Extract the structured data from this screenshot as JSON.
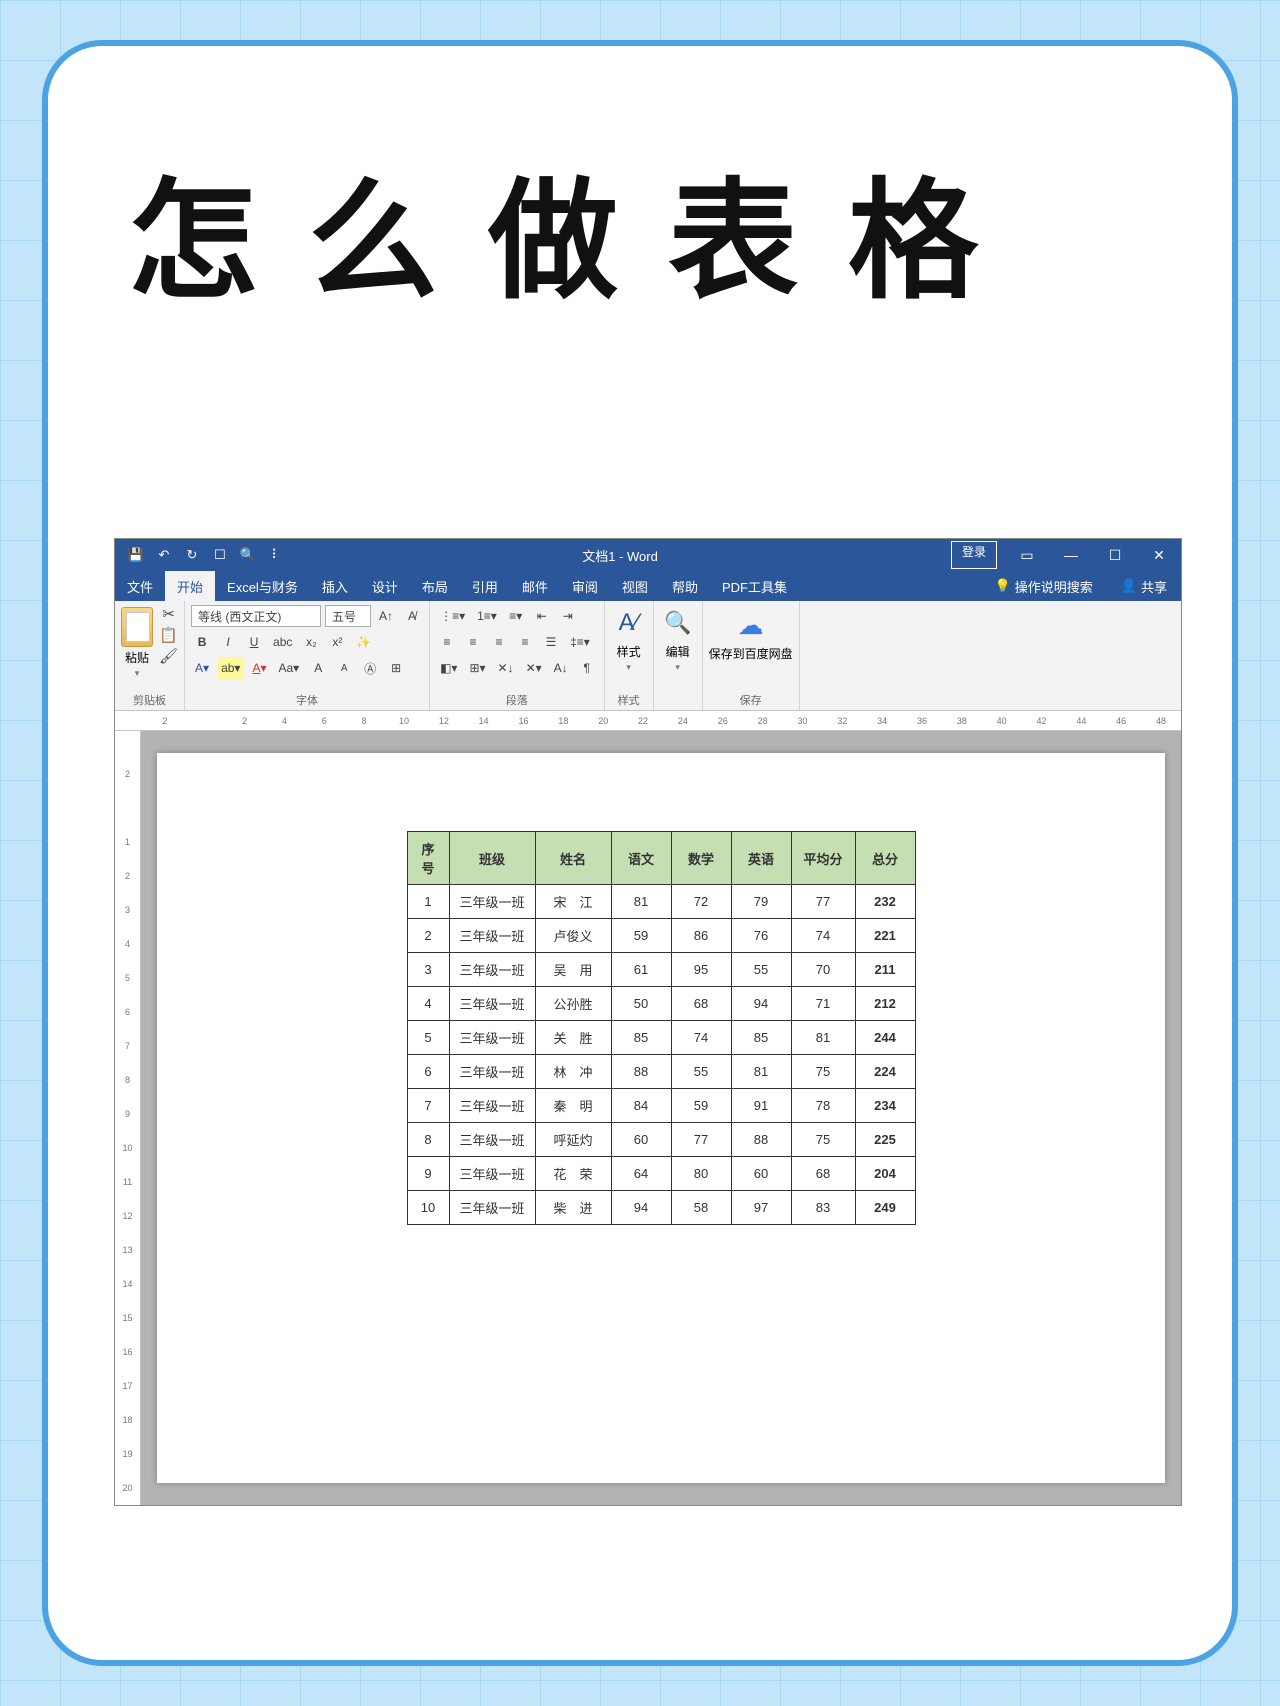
{
  "page_title": "怎么做表格",
  "titlebar": {
    "doc_title": "文档1 - Word",
    "login": "登录"
  },
  "qat": {
    "save": "💾",
    "undo": "↶",
    "redo": "↻",
    "touch": "☐",
    "preview": "🔍"
  },
  "tabs": {
    "file": "文件",
    "home": "开始",
    "excel": "Excel与财务",
    "insert": "插入",
    "design": "设计",
    "layout": "布局",
    "references": "引用",
    "mailings": "邮件",
    "review": "审阅",
    "view": "视图",
    "help": "帮助",
    "pdf": "PDF工具集",
    "tell_me": "操作说明搜索",
    "share": "共享"
  },
  "ribbon": {
    "clipboard": {
      "paste": "粘贴",
      "label": "剪贴板"
    },
    "font": {
      "name": "等线 (西文正文)",
      "size": "五号",
      "label": "字体"
    },
    "paragraph": {
      "label": "段落"
    },
    "styles": {
      "label": "样式",
      "button": "样式"
    },
    "editing": {
      "label": "编辑",
      "button": "编辑"
    },
    "save": {
      "label": "保存",
      "button": "保存到百度网盘"
    }
  },
  "ruler_h": [
    "2",
    "",
    "2",
    "4",
    "6",
    "8",
    "10",
    "12",
    "14",
    "16",
    "18",
    "20",
    "22",
    "24",
    "26",
    "28",
    "30",
    "32",
    "34",
    "36",
    "38",
    "40",
    "42",
    "44",
    "46",
    "48"
  ],
  "ruler_v": [
    "2",
    "",
    "1",
    "2",
    "3",
    "4",
    "5",
    "6",
    "7",
    "8",
    "9",
    "10",
    "11",
    "12",
    "13",
    "14",
    "15",
    "16",
    "17",
    "18",
    "19",
    "20"
  ],
  "table": {
    "headers": [
      "序号",
      "班级",
      "姓名",
      "语文",
      "数学",
      "英语",
      "平均分",
      "总分"
    ],
    "rows": [
      [
        "1",
        "三年级一班",
        "宋　江",
        "81",
        "72",
        "79",
        "77",
        "232"
      ],
      [
        "2",
        "三年级一班",
        "卢俊义",
        "59",
        "86",
        "76",
        "74",
        "221"
      ],
      [
        "3",
        "三年级一班",
        "吴　用",
        "61",
        "95",
        "55",
        "70",
        "211"
      ],
      [
        "4",
        "三年级一班",
        "公孙胜",
        "50",
        "68",
        "94",
        "71",
        "212"
      ],
      [
        "5",
        "三年级一班",
        "关　胜",
        "85",
        "74",
        "85",
        "81",
        "244"
      ],
      [
        "6",
        "三年级一班",
        "林　冲",
        "88",
        "55",
        "81",
        "75",
        "224"
      ],
      [
        "7",
        "三年级一班",
        "秦　明",
        "84",
        "59",
        "91",
        "78",
        "234"
      ],
      [
        "8",
        "三年级一班",
        "呼延灼",
        "60",
        "77",
        "88",
        "75",
        "225"
      ],
      [
        "9",
        "三年级一班",
        "花　荣",
        "64",
        "80",
        "60",
        "68",
        "204"
      ],
      [
        "10",
        "三年级一班",
        "柴　进",
        "94",
        "58",
        "97",
        "83",
        "249"
      ]
    ]
  }
}
